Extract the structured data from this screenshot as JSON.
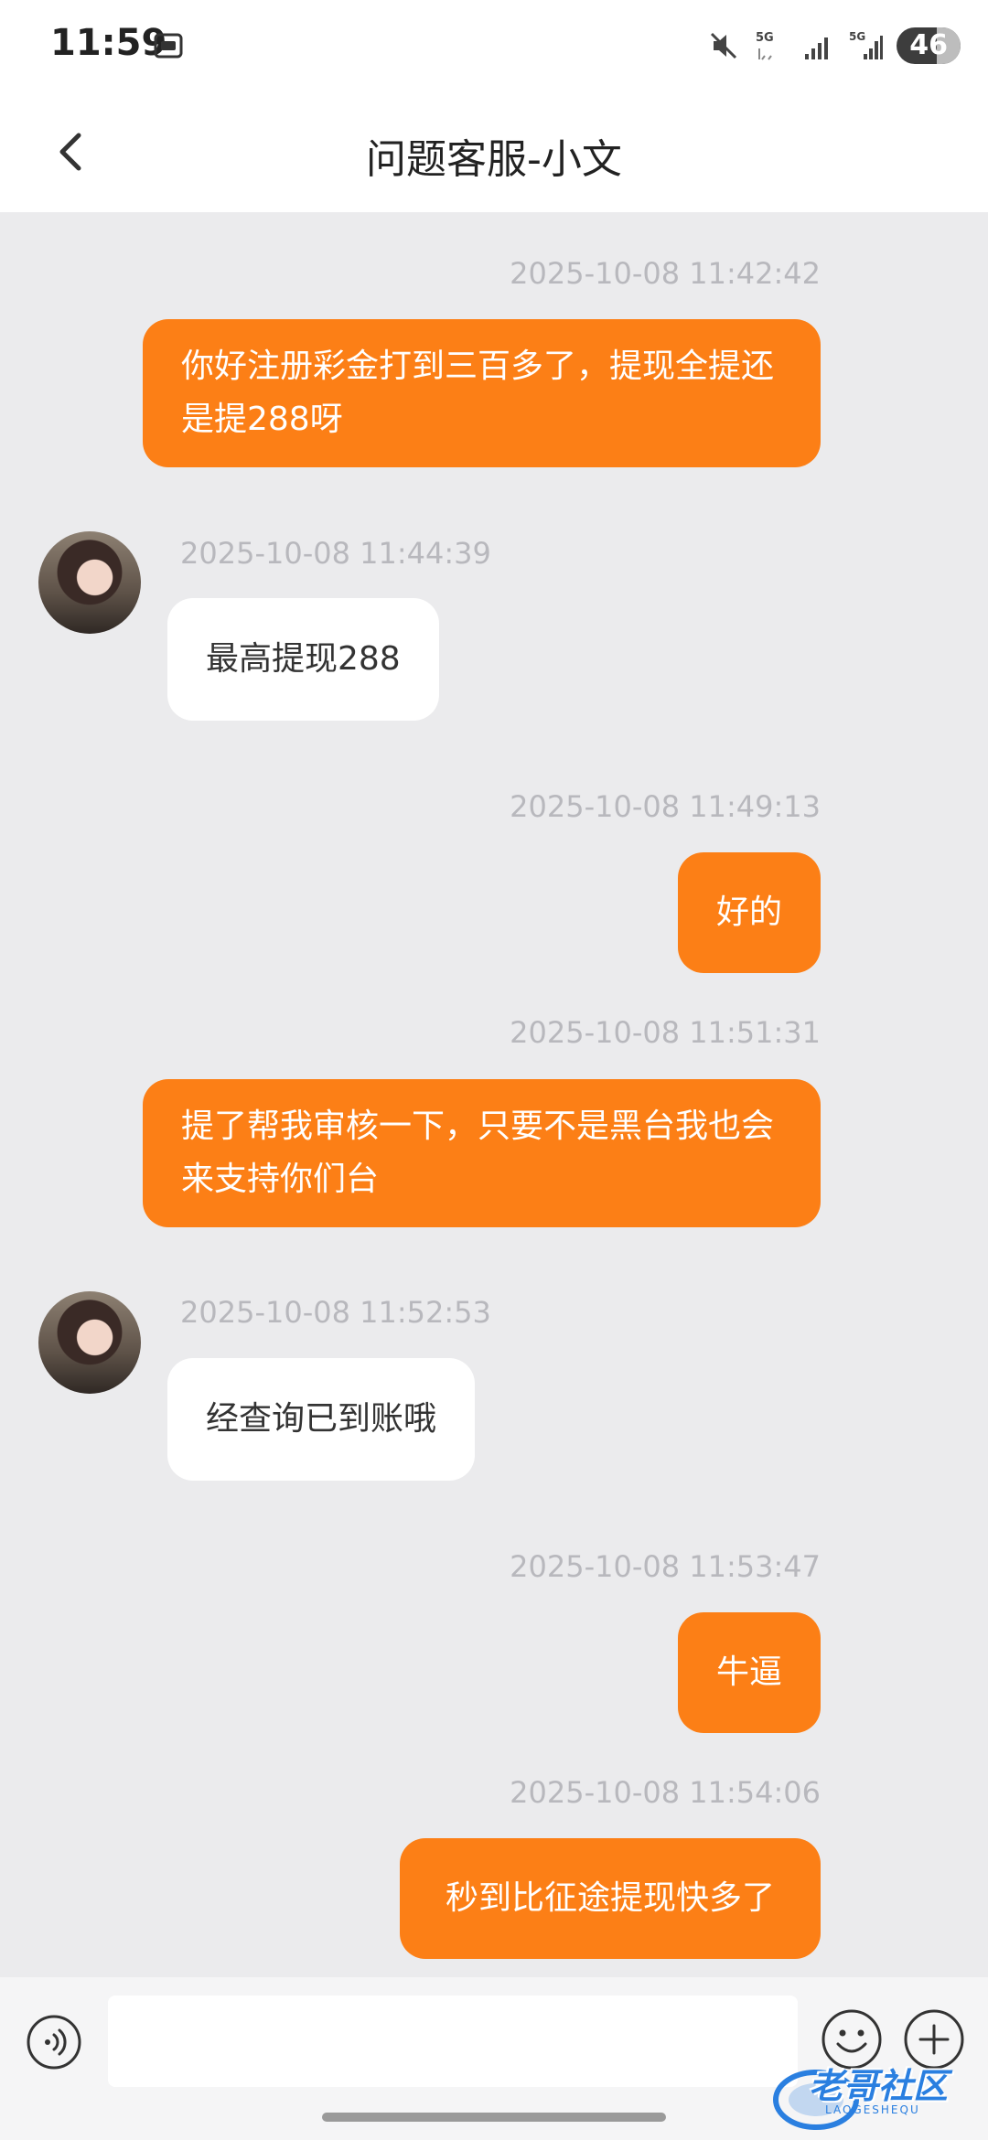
{
  "status_bar": {
    "time": "11:59",
    "network1": "5G",
    "network2": "5G",
    "battery": "46"
  },
  "header": {
    "title": "问题客服-小文"
  },
  "messages": [
    {
      "time": "2025-10-08 11:42:42",
      "side": "out",
      "text": "你好注册彩金打到三百多了，提现全提还是提288呀"
    },
    {
      "time": "2025-10-08 11:44:39",
      "side": "in",
      "text": "最高提现288"
    },
    {
      "time": "2025-10-08 11:49:13",
      "side": "out",
      "text": "好的"
    },
    {
      "time": "2025-10-08 11:51:31",
      "side": "out",
      "text": "提了帮我审核一下，只要不是黑台我也会来支持你们台"
    },
    {
      "time": "2025-10-08 11:52:53",
      "side": "in",
      "text": "经查询已到账哦"
    },
    {
      "time": "2025-10-08 11:53:47",
      "side": "out",
      "text": "牛逼"
    },
    {
      "time": "2025-10-08 11:54:06",
      "side": "out",
      "text": "秒到比征途提现快多了"
    }
  ],
  "input": {
    "value": ""
  },
  "watermark": {
    "text": "老哥社区",
    "sub": "LAOGESHEQU"
  },
  "colors": {
    "outgoing_bubble": "#fc7f16",
    "incoming_bubble": "#ffffff",
    "background": "#ebebed"
  }
}
